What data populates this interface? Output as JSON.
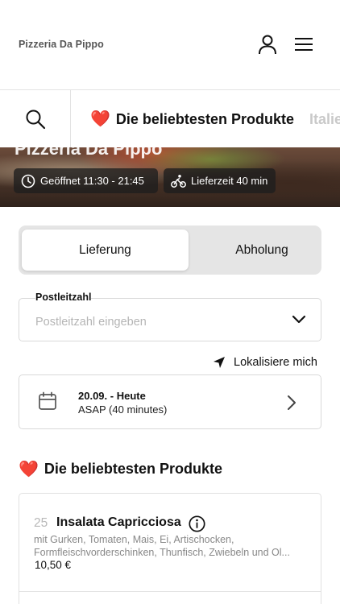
{
  "header": {
    "brand": "Pizzeria Da Pippo",
    "icons": {
      "account": "user-icon",
      "menu": "hamburger-menu-icon"
    }
  },
  "category_bar": {
    "search_icon": "search-icon",
    "active": {
      "emoji": "❤️",
      "label": "Die beliebtesten Produkte"
    },
    "next": {
      "label": "Italie"
    }
  },
  "hero": {
    "title": "Pizzeria Da Pippo",
    "open_hours": "Geöffnet 11:30 - 21:45",
    "delivery_time": "Lieferzeit 40 min",
    "icons": {
      "hours": "clock-icon",
      "delivery": "bicycle-courier-icon"
    }
  },
  "order_type": {
    "options": [
      "Lieferung",
      "Abholung"
    ],
    "selected": "Lieferung"
  },
  "postal_code": {
    "label": "Postleitzahl",
    "placeholder": "Postleitzahl eingeben",
    "value": ""
  },
  "locate": {
    "label": "Lokalisiere mich",
    "icon": "location-arrow-icon"
  },
  "schedule": {
    "date": "20.09. - Heute",
    "time": "ASAP (40 minutes)",
    "icon": "calendar-icon"
  },
  "section": {
    "emoji": "❤️",
    "title": "Die beliebtesten Produkte"
  },
  "products": [
    {
      "number": "25",
      "name": "Insalata Capricciosa",
      "description_line1": "mit Gurken, Tomaten, Mais, Ei, Artischocken,",
      "description_line2": "Formfleischvorderschinken, Thunfisch, Zwiebeln und Ol...",
      "price": "10,50 €"
    }
  ]
}
